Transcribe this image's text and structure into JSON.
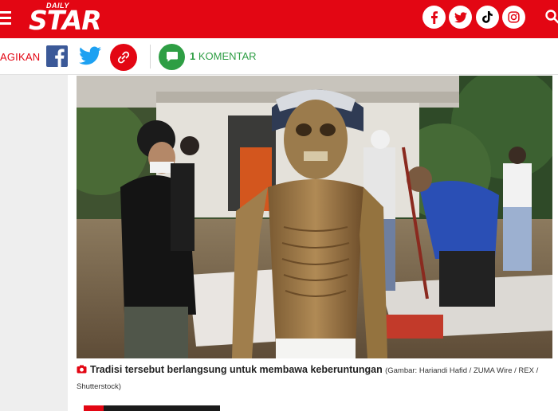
{
  "header": {
    "brand_small": "DAILY",
    "brand_large": "STAR",
    "social_icons": [
      "facebook-icon",
      "twitter-icon",
      "tiktok-icon",
      "instagram-icon"
    ],
    "search_icon": "search-icon",
    "colors": {
      "brand_red": "#e30613"
    }
  },
  "share": {
    "label": "AGIKAN",
    "comment_count": "1",
    "comment_label": "KOMENTAR",
    "colors": {
      "facebook": "#3b5998",
      "twitter": "#1da1f2",
      "comment": "#2e9e44"
    }
  },
  "article": {
    "caption": "Tradisi tersebut berlangsung untuk membawa keberuntungan",
    "credit": "(Gambar: Hariandi Hafid / ZUMA Wire / REX / Shutterstock)"
  }
}
